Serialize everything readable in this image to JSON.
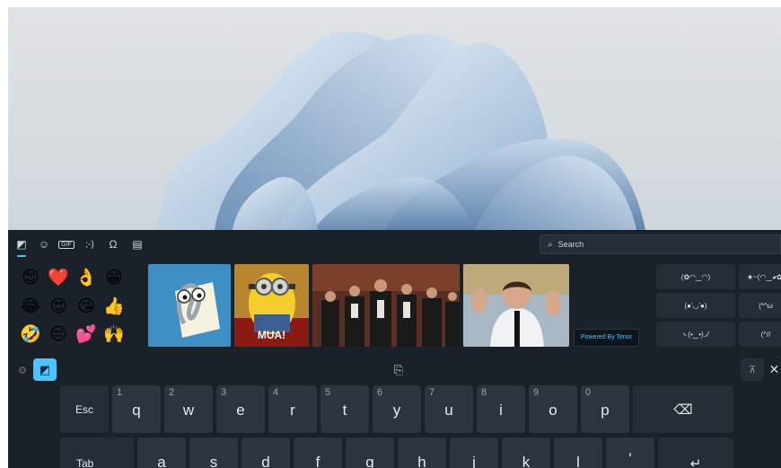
{
  "wallpaper": {
    "name": "Windows 11 Bloom",
    "colors": {
      "sky": "#d6dce0",
      "bloom": "#9fbad6",
      "bloom_light": "#dbe8f4",
      "bloom_dark": "#6e8fb3"
    }
  },
  "keyboard": {
    "colors": {
      "panel": "#1a2129",
      "key": "#2c343d",
      "accent": "#4cc2ff"
    },
    "tabs": [
      {
        "icon": "sticker-icon",
        "glyph": "◩",
        "active": true
      },
      {
        "icon": "emoji-icon",
        "glyph": "☺",
        "active": false
      },
      {
        "icon": "gif-icon",
        "glyph": "GIF",
        "active": false
      },
      {
        "icon": "kaomoji-icon",
        "glyph": ";-)",
        "active": false
      },
      {
        "icon": "symbols-icon",
        "glyph": "Ω",
        "active": false
      },
      {
        "icon": "clipboard-history-icon",
        "glyph": "▤",
        "active": false
      }
    ],
    "search": {
      "icon": "search-icon",
      "glyph": "⌕",
      "placeholder": "Search"
    },
    "emojis": [
      "😊",
      "❤️",
      "👌",
      "😁",
      "😂",
      "😍",
      "😘",
      "👍",
      "🤣",
      "😒",
      "💕",
      "🙌"
    ],
    "gifs": [
      {
        "name": "clippy",
        "caption": ""
      },
      {
        "name": "minion",
        "caption": "MUA!"
      },
      {
        "name": "applause-crowd",
        "caption": ""
      },
      {
        "name": "applauding-man",
        "caption": ""
      }
    ],
    "powered_by": "Powered By Tenor",
    "kaomoji": [
      [
        "(✿◠‿◠)",
        "★~(◠‿◕✿)"
      ],
      [
        "(●'◡'●)",
        "(*^ω"
      ],
      [
        "ヽ(•‿•)ノ",
        "(^//"
      ]
    ],
    "toolbar": {
      "gear_icon": "gear-icon",
      "sticker_icon": "sticker-icon",
      "clipboard_icon": "clipboard-icon",
      "dock_icon": "dock-icon",
      "close_glyph": "✕"
    },
    "rows": [
      [
        {
          "label": "Esc",
          "num": "",
          "fn": true
        },
        {
          "label": "q",
          "num": "1"
        },
        {
          "label": "w",
          "num": "2"
        },
        {
          "label": "e",
          "num": "3"
        },
        {
          "label": "r",
          "num": "4"
        },
        {
          "label": "t",
          "num": "5"
        },
        {
          "label": "y",
          "num": "6"
        },
        {
          "label": "u",
          "num": "7"
        },
        {
          "label": "i",
          "num": "8"
        },
        {
          "label": "o",
          "num": "9"
        },
        {
          "label": "p",
          "num": "0"
        },
        {
          "label": "⌫",
          "num": "",
          "fn": true
        }
      ],
      [
        {
          "label": "Tab",
          "num": "",
          "fn": true
        },
        {
          "label": "a",
          "num": ""
        },
        {
          "label": "s",
          "num": ""
        },
        {
          "label": "d",
          "num": ""
        },
        {
          "label": "f",
          "num": ""
        },
        {
          "label": "g",
          "num": ""
        },
        {
          "label": "h",
          "num": ""
        },
        {
          "label": "j",
          "num": ""
        },
        {
          "label": "k",
          "num": ""
        },
        {
          "label": "l",
          "num": ""
        },
        {
          "label": "'",
          "num": ""
        },
        {
          "label": "↵",
          "num": "",
          "fn": true
        }
      ]
    ]
  }
}
